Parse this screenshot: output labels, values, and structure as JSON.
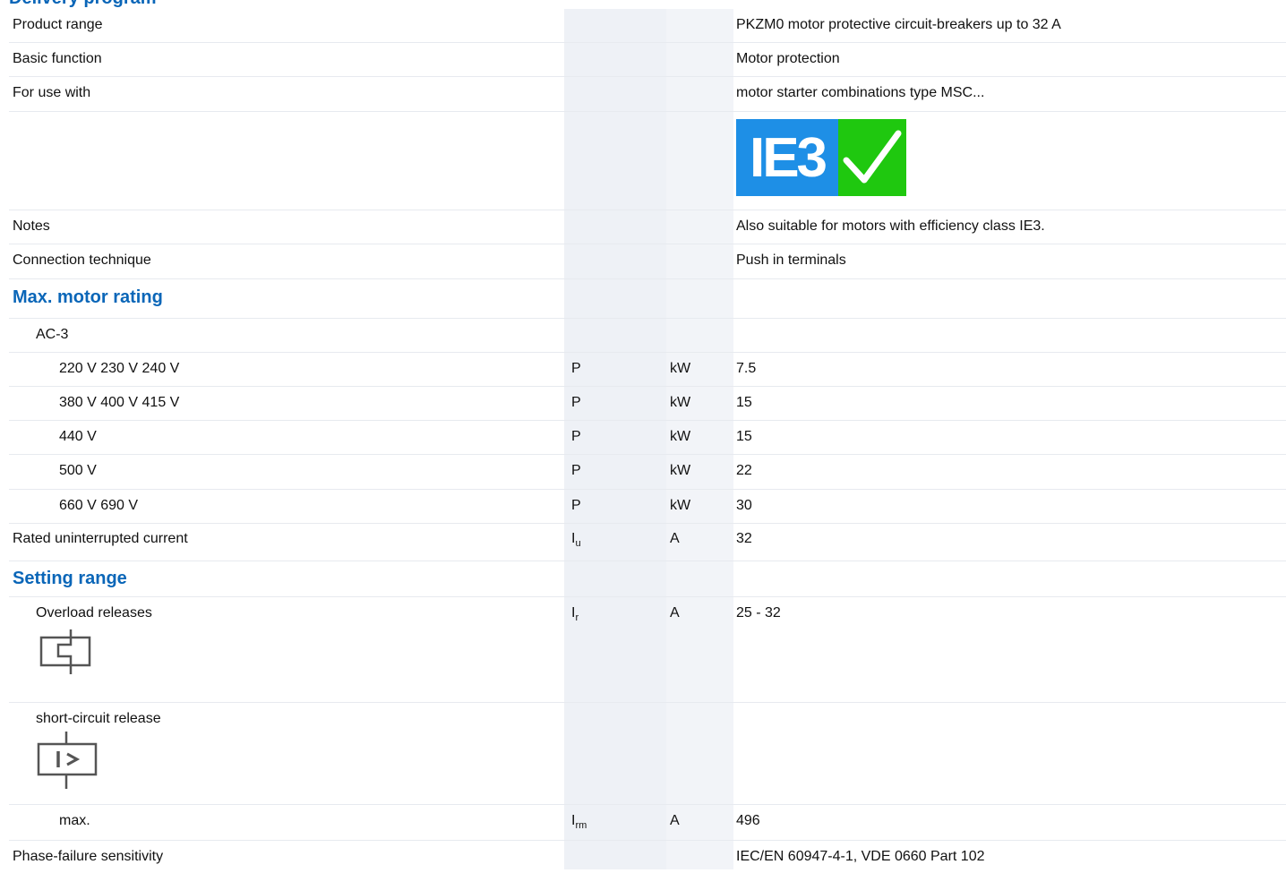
{
  "top_heading": "Delivery program",
  "rows": [
    {
      "label": "Product range",
      "value": "PKZM0 motor protective circuit-breakers up to 32 A"
    },
    {
      "label": "Basic function",
      "value": "Motor protection"
    },
    {
      "label": "For use with",
      "value": "motor starter combinations type MSC..."
    },
    {
      "label": "",
      "value": ""
    },
    {
      "label": "Notes",
      "value": "Also suitable for motors with efficiency class IE3."
    },
    {
      "label": "Connection technique",
      "value": "Push in terminals"
    },
    {
      "label": "Max. motor rating"
    },
    {
      "label": "AC-3"
    },
    {
      "label": "220 V 230 V 240 V",
      "symbol": "P",
      "unit": "kW",
      "value": "7.5"
    },
    {
      "label": "380 V 400 V 415 V",
      "symbol": "P",
      "unit": "kW",
      "value": "15"
    },
    {
      "label": "440 V",
      "symbol": "P",
      "unit": "kW",
      "value": "15"
    },
    {
      "label": "500 V",
      "symbol": "P",
      "unit": "kW",
      "value": "22"
    },
    {
      "label": "660 V 690 V",
      "symbol": "P",
      "unit": "kW",
      "value": "30"
    },
    {
      "label": "Rated uninterrupted current",
      "symbol": "I",
      "symbol_sub": "u",
      "unit": "A",
      "value": "32"
    },
    {
      "label": "Setting range"
    },
    {
      "label": "Overload releases",
      "symbol": "I",
      "symbol_sub": "r",
      "unit": "A",
      "value": "25 - 32"
    },
    {
      "label": "short-circuit release"
    },
    {
      "label": "max.",
      "symbol": "I",
      "symbol_sub": "rm",
      "unit": "A",
      "value": "496"
    },
    {
      "label": "Phase-failure sensitivity",
      "value": "IEC/EN 60947-4-1, VDE 0660 Part 102"
    }
  ],
  "badge": {
    "text": "IE3",
    "icon": "checkmark-icon",
    "blue": "#1e8fe6",
    "green": "#1fc80f"
  },
  "colors": {
    "section_heading": "#0a66b8",
    "column_shade": "#eef1f6"
  },
  "icons": {
    "overload": "thermal-overload-release-icon",
    "short_circuit": "short-circuit-release-icon"
  }
}
